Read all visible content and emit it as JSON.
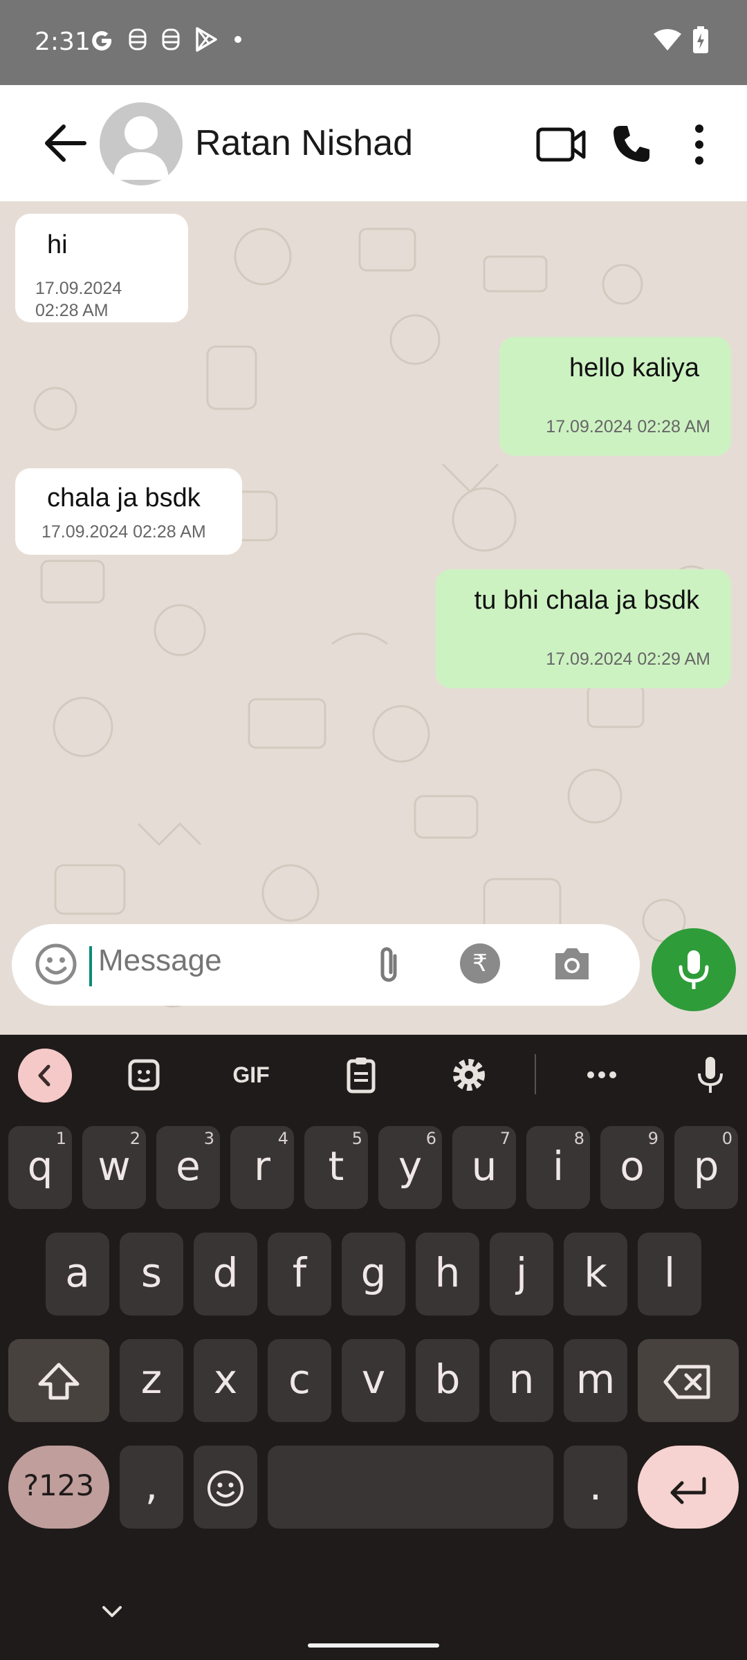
{
  "status_bar": {
    "time": "2:31",
    "icons": [
      "google-icon",
      "notification-icon",
      "notification-icon",
      "play-store-icon",
      "dot-icon",
      "wifi-icon",
      "battery-icon"
    ]
  },
  "header": {
    "contact_name": "Ratan Nishad",
    "icons": [
      "back-arrow-icon",
      "avatar-icon",
      "video-call-icon",
      "phone-icon",
      "more-vert-icon"
    ]
  },
  "messages": [
    {
      "direction": "incoming",
      "text": "hi",
      "date": "17.09.2024",
      "time": "02:28 AM"
    },
    {
      "direction": "outgoing",
      "text": "hello kaliya",
      "timestamp": "17.09.2024 02:28 AM"
    },
    {
      "direction": "incoming",
      "text": "chala ja bsdk",
      "timestamp": "17.09.2024 02:28 AM"
    },
    {
      "direction": "outgoing",
      "text": "tu bhi chala ja bsdk",
      "timestamp": "17.09.2024 02:29 AM"
    }
  ],
  "composer": {
    "placeholder": "Message",
    "rupee_symbol": "₹",
    "accent": "#2f9c3a"
  },
  "keyboard": {
    "toolbar": {
      "gif_label": "GIF"
    },
    "row1": [
      {
        "key": "q",
        "hint": "1"
      },
      {
        "key": "w",
        "hint": "2"
      },
      {
        "key": "e",
        "hint": "3"
      },
      {
        "key": "r",
        "hint": "4"
      },
      {
        "key": "t",
        "hint": "5"
      },
      {
        "key": "y",
        "hint": "6"
      },
      {
        "key": "u",
        "hint": "7"
      },
      {
        "key": "i",
        "hint": "8"
      },
      {
        "key": "o",
        "hint": "9"
      },
      {
        "key": "p",
        "hint": "0"
      }
    ],
    "row2": [
      "a",
      "s",
      "d",
      "f",
      "g",
      "h",
      "j",
      "k",
      "l"
    ],
    "row3": [
      "z",
      "x",
      "c",
      "v",
      "b",
      "n",
      "m"
    ],
    "symbols_label": "?123",
    "comma": ",",
    "period": "."
  }
}
